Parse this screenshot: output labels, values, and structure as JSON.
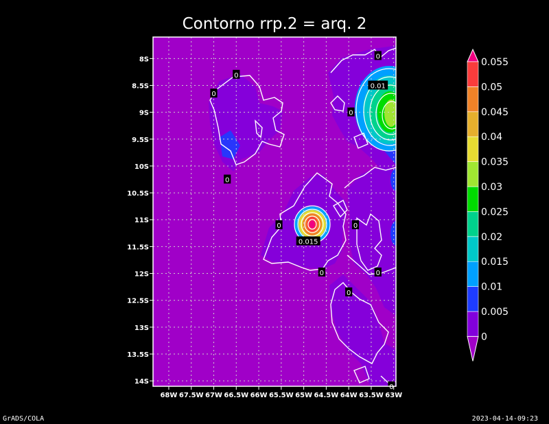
{
  "chart_data": {
    "type": "heatmap",
    "title": "Contorno rrp.2 = arq. 2",
    "x_ticks": [
      "68W",
      "67.5W",
      "67W",
      "66.5W",
      "66W",
      "65.5W",
      "65W",
      "64.5W",
      "64W",
      "63.5W",
      "63W"
    ],
    "y_ticks": [
      "8S",
      "8.5S",
      "9S",
      "9.5S",
      "10S",
      "10.5S",
      "11S",
      "11.5S",
      "12S",
      "12.5S",
      "13S",
      "13.5S",
      "14S"
    ],
    "xlim": [
      -68.35,
      -62.95
    ],
    "ylim": [
      -14.1,
      -7.6
    ],
    "grid": true,
    "colorbar": {
      "levels": [
        "0",
        "0.005",
        "0.01",
        "0.015",
        "0.02",
        "0.025",
        "0.03",
        "0.035",
        "0.04",
        "0.045",
        "0.05",
        "0.055"
      ],
      "colors": [
        "#a000c8",
        "#8200dc",
        "#1e3cff",
        "#00a0ff",
        "#00c8c8",
        "#00d28c",
        "#00dc00",
        "#a0e632",
        "#e6dc32",
        "#e6af2d",
        "#f08228",
        "#fa3c3c",
        "#f00082"
      ]
    },
    "contour_labels": [
      {
        "text": "0",
        "lon": -63.35,
        "lat": -7.95
      },
      {
        "text": "0",
        "lon": -66.5,
        "lat": -8.3
      },
      {
        "text": "0",
        "lon": -67.0,
        "lat": -8.65
      },
      {
        "text": "0.01",
        "lon": -63.35,
        "lat": -8.5
      },
      {
        "text": "0",
        "lon": -63.95,
        "lat": -9.0
      },
      {
        "text": "0",
        "lon": -66.7,
        "lat": -10.25
      },
      {
        "text": "0",
        "lon": -65.55,
        "lat": -11.1
      },
      {
        "text": "0",
        "lon": -63.85,
        "lat": -11.1
      },
      {
        "text": "0.015",
        "lon": -64.9,
        "lat": -11.4
      },
      {
        "text": "0",
        "lon": -64.6,
        "lat": -11.98
      },
      {
        "text": "0",
        "lon": -63.35,
        "lat": -11.98
      },
      {
        "text": "0",
        "lon": -64.0,
        "lat": -12.35
      },
      {
        "text": "0",
        "lon": -63.05,
        "lat": -14.1
      }
    ]
  },
  "footer": {
    "left": "GrADS/COLA",
    "right": "2023-04-14-09:23"
  }
}
